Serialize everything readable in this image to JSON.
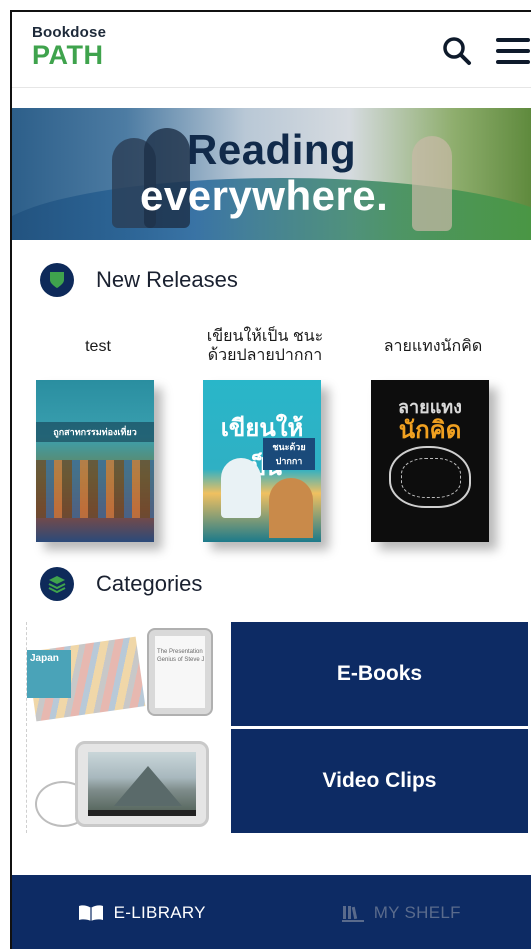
{
  "header": {
    "logo_top": "Bookdose",
    "logo_main": "PATH",
    "search_icon": "search-icon",
    "menu_icon": "hamburger-menu-icon"
  },
  "banner": {
    "line1": "Reading",
    "line2": "everywhere."
  },
  "new_releases": {
    "title": "New Releases",
    "icon": "shield-icon",
    "books": [
      {
        "title": "test",
        "cover_text": "ถูกสาทกรรมท่องเที่ยว"
      },
      {
        "title": "เขียนให้เป็น ชนะ ด้วยปลายปากกา",
        "cover_text": "เขียนให้เป็น",
        "cover_sub": "ชนะด้วยปากกา"
      },
      {
        "title": "ลายแทงนักคิด",
        "cover_text_top": "ลายแทง",
        "cover_text": "นักคิด"
      }
    ]
  },
  "categories": {
    "title": "Categories",
    "icon": "layers-icon",
    "items": [
      {
        "label": "E-Books",
        "thumb_text": "Japan",
        "tablet_text": "The Presentation Genius of Steve J"
      },
      {
        "label": "Video Clips"
      }
    ]
  },
  "bottom_nav": {
    "library_label": "E-LIBRARY",
    "library_icon": "open-book-icon",
    "shelf_label": "MY SHELF",
    "shelf_icon": "bookshelf-icon"
  },
  "colors": {
    "navy": "#0d2b64",
    "brand_green": "#3fa34d",
    "inactive_nav": "#5a6b8c"
  }
}
